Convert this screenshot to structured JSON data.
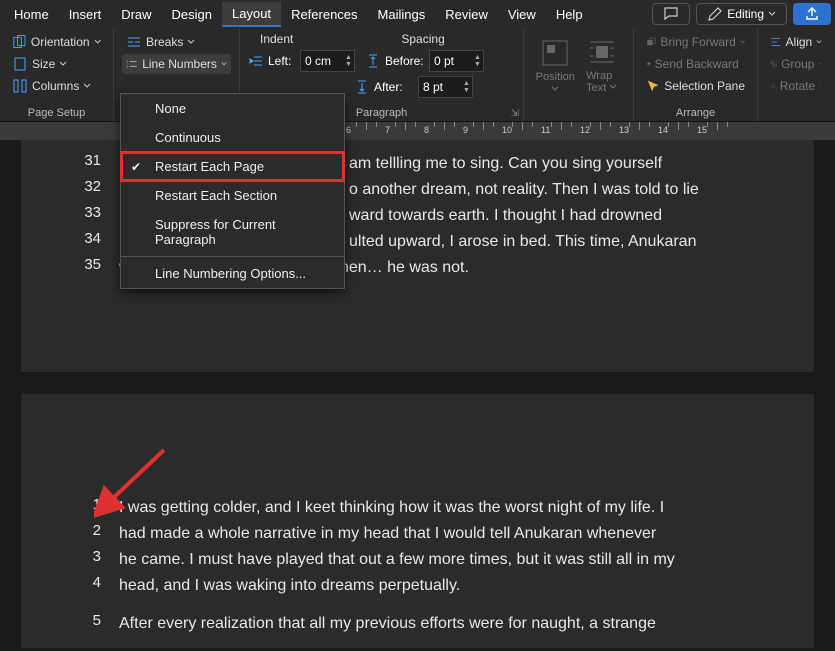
{
  "menubar": {
    "items": [
      "Home",
      "Insert",
      "Draw",
      "Design",
      "Layout",
      "References",
      "Mailings",
      "Review",
      "View",
      "Help"
    ],
    "active": "Layout",
    "comments_tooltip": "Comments",
    "editing_label": "Editing",
    "share_label": ""
  },
  "ribbon": {
    "page_setup": {
      "label": "Page Setup",
      "orientation": "Orientation",
      "size": "Size",
      "columns": "Columns",
      "breaks": "Breaks",
      "line_numbers": "Line Numbers",
      "hyphenation": ""
    },
    "paragraph": {
      "label": "Paragraph",
      "indent_header": "Indent",
      "spacing_header": "Spacing",
      "left_label": "Left:",
      "left_value": "0 cm",
      "before_label": "Before:",
      "before_value": "0 pt",
      "after_label": "After:",
      "after_value": "8 pt"
    },
    "position": {
      "label": "Position"
    },
    "wrap": {
      "label1": "Wrap",
      "label2": "Text"
    },
    "arrange": {
      "label": "Arrange",
      "bring_forward": "Bring Forward",
      "send_backward": "Send Backward",
      "selection_pane": "Selection Pane",
      "align": "Align",
      "group": "Group",
      "rotate": "Rotate"
    }
  },
  "dropdown": {
    "items": [
      {
        "label": "None",
        "selected": false
      },
      {
        "label": "Continuous",
        "selected": false
      },
      {
        "label": "Restart Each Page",
        "selected": true,
        "highlighted": true
      },
      {
        "label": "Restart Each Section",
        "selected": false
      },
      {
        "label": "Suppress for Current Paragraph",
        "selected": false
      }
    ],
    "sep_after": 4,
    "last": {
      "label": "Line Numbering Options...",
      "selected": false
    }
  },
  "document": {
    "page1": {
      "lines": [
        {
          "n": 31,
          "t": "am tellling me to sing. Can you sing yourself"
        },
        {
          "n": 32,
          "t": "o another dream, not reality. Then I was told to lie"
        },
        {
          "n": 33,
          "t": "ward towards earth. I thought I had drowned"
        },
        {
          "n": 34,
          "t": "ulted upward, I arose in bed. This time, Anukaran"
        },
        {
          "n": 35,
          "t": "was here, as I'd expected, but then… he was not."
        }
      ]
    },
    "page2": {
      "paragraphs": [
        {
          "start": 1,
          "lines": [
            "I was getting colder, and I keet thinking how it was the worst night of my life. I",
            "had made a whole narrative in my head that I would tell Anukaran whenever",
            "he came. I must have played that out a few more times, but it was still all in my",
            "head, and I was waking into dreams perpetually."
          ]
        },
        {
          "start": 5,
          "lines": [
            "After every realization that all my previous efforts were for naught, a strange"
          ]
        }
      ]
    }
  },
  "ruler": {
    "visible_numbers": [
      6,
      7,
      8,
      9,
      10,
      11,
      12,
      13,
      14,
      15
    ]
  }
}
